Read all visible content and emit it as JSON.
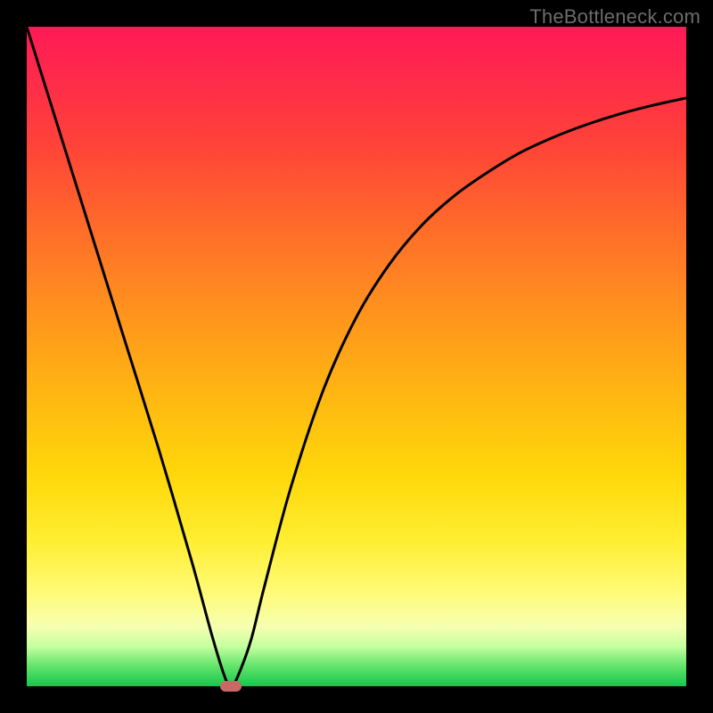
{
  "watermark": "TheBottleneck.com",
  "chart_data": {
    "type": "line",
    "title": "",
    "xlabel": "",
    "ylabel": "",
    "xlim": [
      0,
      100
    ],
    "ylim": [
      0,
      100
    ],
    "series": [
      {
        "name": "bottleneck-curve",
        "x": [
          0,
          5,
          10,
          15,
          20,
          25,
          28,
          30,
          31,
          32,
          34,
          36,
          40,
          45,
          50,
          55,
          60,
          65,
          70,
          75,
          80,
          85,
          90,
          95,
          100
        ],
        "values": [
          100,
          84,
          68,
          52,
          36,
          19,
          8,
          1.5,
          0,
          1.5,
          7,
          15,
          30,
          45,
          56,
          64,
          70,
          74.5,
          78,
          81,
          83.3,
          85.2,
          86.8,
          88.1,
          89.2
        ]
      }
    ],
    "annotations": [
      {
        "name": "minimum-marker",
        "x": 31,
        "y": 0
      }
    ],
    "grid": false,
    "legend": false
  }
}
